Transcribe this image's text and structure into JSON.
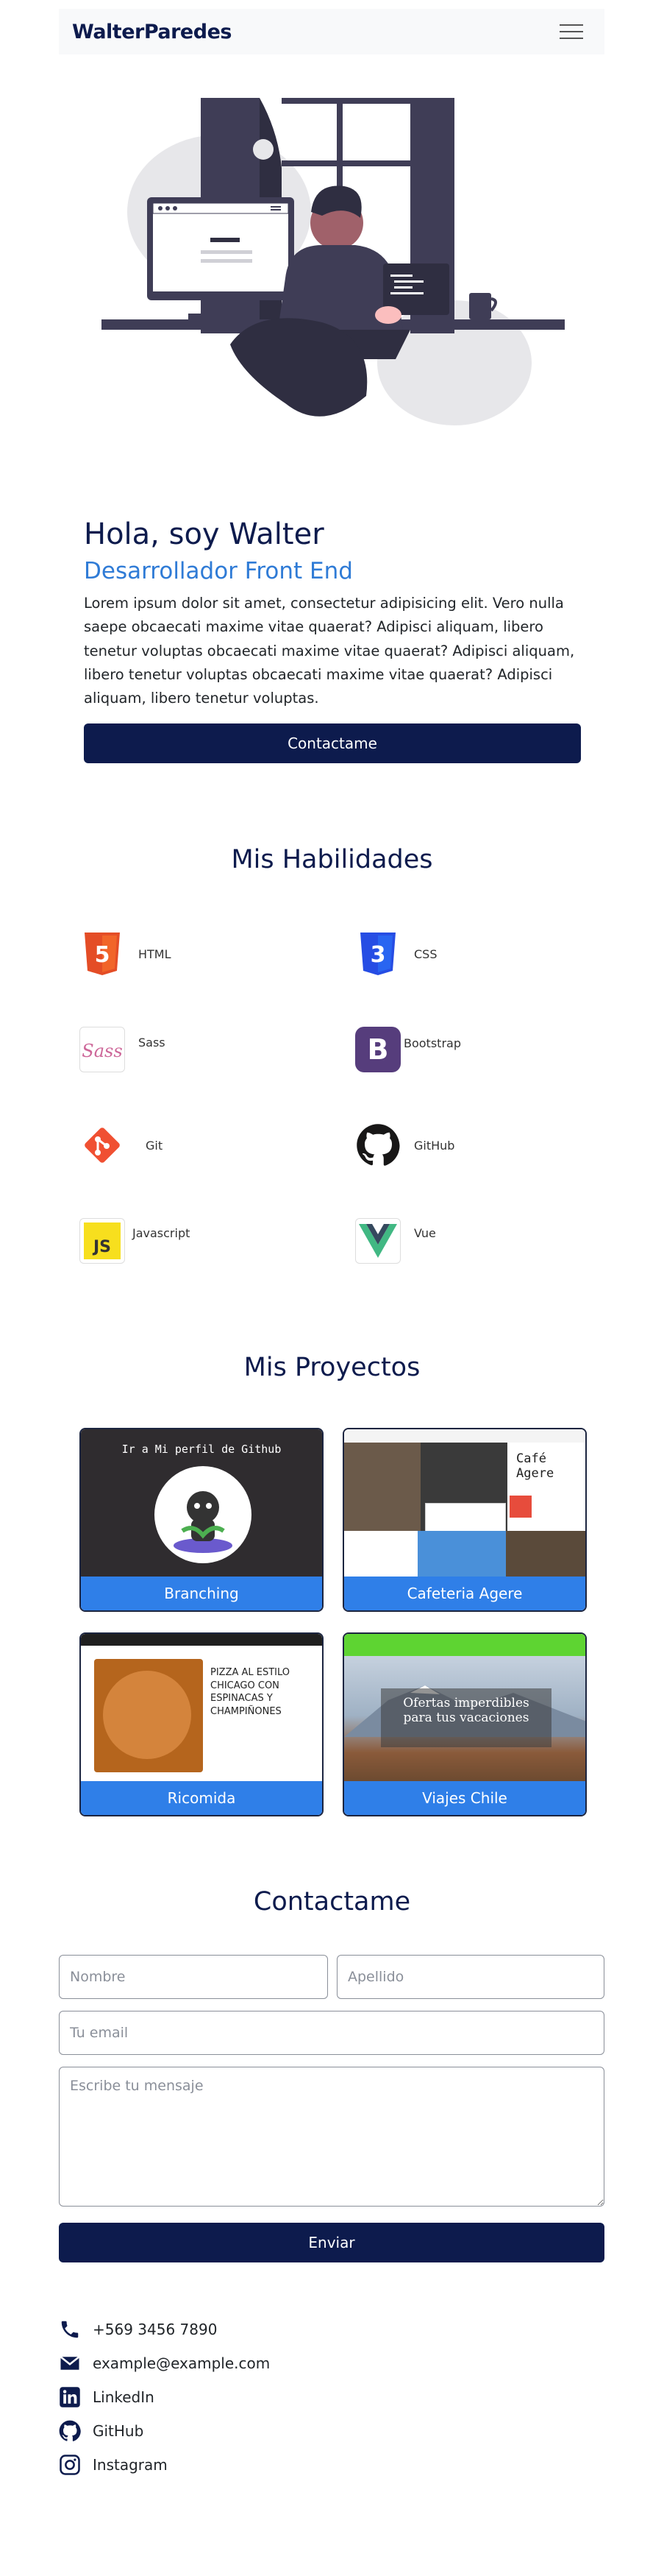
{
  "nav": {
    "brand": "WalterParedes",
    "toggler_icon": "hamburger-icon"
  },
  "hero": {
    "title": "Hola, soy Walter",
    "subtitle": "Desarrollador Front End",
    "text": "Lorem ipsum dolor sit amet, consectetur adipisicing elit. Vero nulla saepe obcaecati maxime vitae quaerat? Adipisci aliquam, libero tenetur voluptas obcaecati maxime vitae quaerat? Adipisci aliquam, libero tenetur voluptas obcaecati maxime vitae quaerat? Adipisci aliquam, libero tenetur voluptas.",
    "cta": "Contactame"
  },
  "skills": {
    "title": "Mis Habilidades",
    "items": [
      {
        "label": "HTML",
        "icon": "html5-icon",
        "color": "#e44d26",
        "glyph": "5"
      },
      {
        "label": "CSS",
        "icon": "css3-icon",
        "color": "#2965f1",
        "glyph": "3"
      },
      {
        "label": "Sass",
        "icon": "sass-icon",
        "color": "#cd6799",
        "glyph": "Sass"
      },
      {
        "label": "Bootstrap",
        "icon": "bootstrap-icon",
        "color": "#563d7c",
        "glyph": "B"
      },
      {
        "label": "Git",
        "icon": "git-icon",
        "color": "#f05032",
        "glyph": "◆"
      },
      {
        "label": "GitHub",
        "icon": "github-icon",
        "color": "#181717",
        "glyph": ""
      },
      {
        "label": "Javascript",
        "icon": "javascript-icon",
        "color": "#f7df1e",
        "glyph": "JS"
      },
      {
        "label": "Vue",
        "icon": "vue-icon",
        "color": "#41b883",
        "glyph": "V"
      }
    ]
  },
  "projects": {
    "title": "Mis Proyectos",
    "items": [
      {
        "label": "Branching",
        "thumb_text": "Ir a Mi perfil de Github"
      },
      {
        "label": "Cafeteria Agere",
        "thumb_text": "Café Agere"
      },
      {
        "label": "Ricomida",
        "thumb_text": "PIZZA AL ESTILO CHICAGO CON ESPINACAS Y CHAMPIÑONES"
      },
      {
        "label": "Viajes Chile",
        "thumb_text": "Ofertas imperdibles para tus vacaciones"
      }
    ]
  },
  "contact": {
    "title": "Contactame",
    "name_placeholder": "Nombre",
    "lastname_placeholder": "Apellido",
    "email_placeholder": "Tu email",
    "message_placeholder": "Escribe tu mensaje",
    "submit": "Enviar"
  },
  "info": {
    "phone": "+569 3456 7890",
    "email": "example@example.com",
    "linkedin": "LinkedIn",
    "github": "GitHub",
    "instagram": "Instagram"
  },
  "colors": {
    "navy": "#0d1b4d",
    "accent": "#2f7bd6",
    "card_caption": "#2f7fe8"
  }
}
